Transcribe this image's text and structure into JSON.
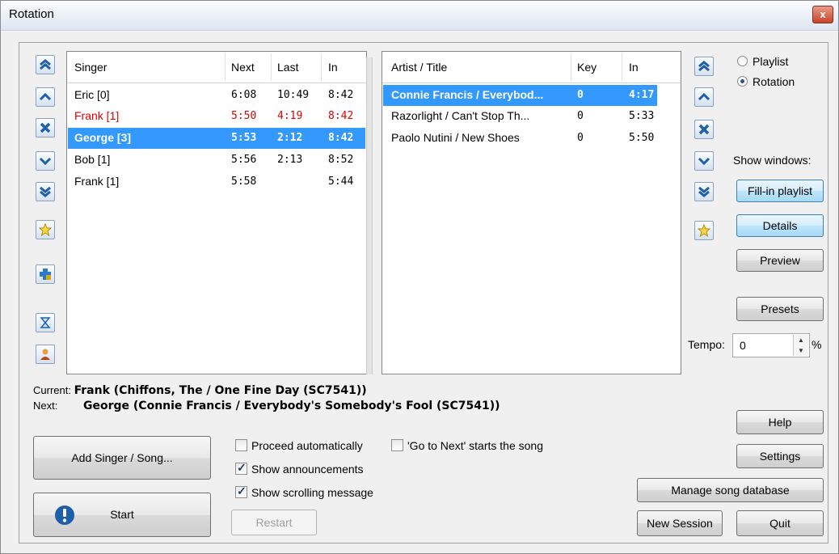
{
  "window": {
    "title": "Rotation",
    "close": "x"
  },
  "singers": {
    "headers": [
      "Singer",
      "Next",
      "Last",
      "In"
    ],
    "rows": [
      {
        "name": "Eric [0]",
        "next": "6:08",
        "last": "10:49",
        "in": "8:42",
        "state": "normal"
      },
      {
        "name": "Frank [1]",
        "next": "5:50",
        "last": "4:19",
        "in": "8:42",
        "state": "red"
      },
      {
        "name": "George [3]",
        "next": "5:53",
        "last": "2:12",
        "in": "8:42",
        "state": "selected"
      },
      {
        "name": "Bob [1]",
        "next": "5:56",
        "last": "2:13",
        "in": "8:52",
        "state": "normal"
      },
      {
        "name": "Frank [1]",
        "next": "5:58",
        "last": "",
        "in": "5:44",
        "state": "normal"
      }
    ]
  },
  "songs": {
    "headers": [
      "Artist / Title",
      "Key",
      "In"
    ],
    "rows": [
      {
        "title": "Connie Francis / Everybod...",
        "key": "0",
        "in": "4:17",
        "state": "selected"
      },
      {
        "title": "Razorlight / Can't Stop Th...",
        "key": "0",
        "in": "5:33",
        "state": "normal"
      },
      {
        "title": "Paolo Nutini / New Shoes",
        "key": "0",
        "in": "5:50",
        "state": "normal"
      }
    ]
  },
  "mode": {
    "playlist": "Playlist",
    "rotation": "Rotation",
    "selected": "rotation"
  },
  "show_windows": {
    "label": "Show windows:",
    "fill_in": "Fill-in playlist",
    "details": "Details",
    "preview": "Preview"
  },
  "presets": "Presets",
  "tempo": {
    "label": "Tempo:",
    "value": "0",
    "unit": "%"
  },
  "status": {
    "current_label": "Current:",
    "current_value": "Frank (Chiffons, The / One Fine Day (SC7541))",
    "next_label": "Next:",
    "next_value": "George (Connie Francis / Everybody's Somebody's Fool (SC7541))"
  },
  "buttons": {
    "add_singer": "Add Singer / Song...",
    "start": "Start",
    "restart": "Restart",
    "help": "Help",
    "settings": "Settings",
    "manage_db": "Manage song database",
    "new_session": "New Session",
    "quit": "Quit"
  },
  "options": {
    "proceed": {
      "label": "Proceed automatically",
      "checked": false
    },
    "go_next": {
      "label": "'Go to Next' starts the song",
      "checked": false
    },
    "announce": {
      "label": "Show announcements",
      "checked": true
    },
    "scrolling": {
      "label": "Show scrolling message",
      "checked": true
    }
  },
  "colors": {
    "selection": "#3399ff",
    "red_text": "#e00000",
    "accent": "#1f5fa8"
  }
}
